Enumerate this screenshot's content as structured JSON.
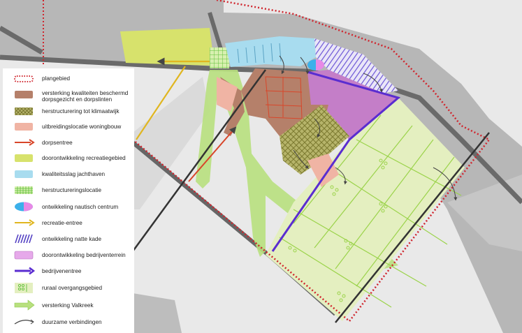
{
  "legend": {
    "items": [
      {
        "key": "plangebied",
        "label": "plangebied"
      },
      {
        "key": "versterking",
        "label": "versterking kwaliteiten beschermd dorpsgezicht en dorpslinten"
      },
      {
        "key": "herstructurering_klimaat",
        "label": "herstructurering tot klimaatwijk"
      },
      {
        "key": "uitbreiding",
        "label": "uitbreidingslocatie woningbouw"
      },
      {
        "key": "dorpsentree",
        "label": "dorpsentree"
      },
      {
        "key": "recreatie_gebied",
        "label": "doorontwikkeling recreatiegebied"
      },
      {
        "key": "jachthaven",
        "label": "kwaliteitsslag jachthaven"
      },
      {
        "key": "herstructurering_locatie",
        "label": "herstructureringslocatie"
      },
      {
        "key": "nautisch",
        "label": "ontwikkeling nautisch centrum"
      },
      {
        "key": "recreatie_entree",
        "label": "recreatie-entree"
      },
      {
        "key": "natte_kade",
        "label": "ontwikkeling natte kade"
      },
      {
        "key": "bedrijventerrein",
        "label": "doorontwikkeling bedrijventerrein"
      },
      {
        "key": "bedrijvenentree",
        "label": "bedrijvenentree"
      },
      {
        "key": "ruraal",
        "label": "ruraal overgangsgebied"
      },
      {
        "key": "valkreek",
        "label": "versterking Valkreek"
      },
      {
        "key": "verbindingen",
        "label": "duurzame verbindingen"
      }
    ]
  },
  "colors": {
    "background": "#e9e9e9",
    "built": "#b5b5b5",
    "road": "#6e6e6e",
    "plangebied": "#d0262e",
    "versterking": "#b5806a",
    "klimaatwijk": "#9c9c4a",
    "uitbreiding": "#f0b4a4",
    "dorpsentree": "#d8462a",
    "recreatie": "#d7e26c",
    "jachthaven": "#a8dcef",
    "herstructurering": "#a9de6e",
    "nautisch_a": "#3cb0ea",
    "nautisch_b": "#e889e6",
    "recreatie_entree": "#e0b620",
    "natte_kade": "#5543c4",
    "bedrijventerrein": "#c47ec8",
    "bedrijvenentree": "#5a2dd0",
    "ruraal": "#e4efc0",
    "ruraal_line": "#9bd34a",
    "valkreek": "#b8e07e",
    "verbinding": "#444444"
  },
  "icons": [
    "arrow-icon",
    "hatch-icon",
    "grid-icon",
    "dot-pattern-icon"
  ]
}
